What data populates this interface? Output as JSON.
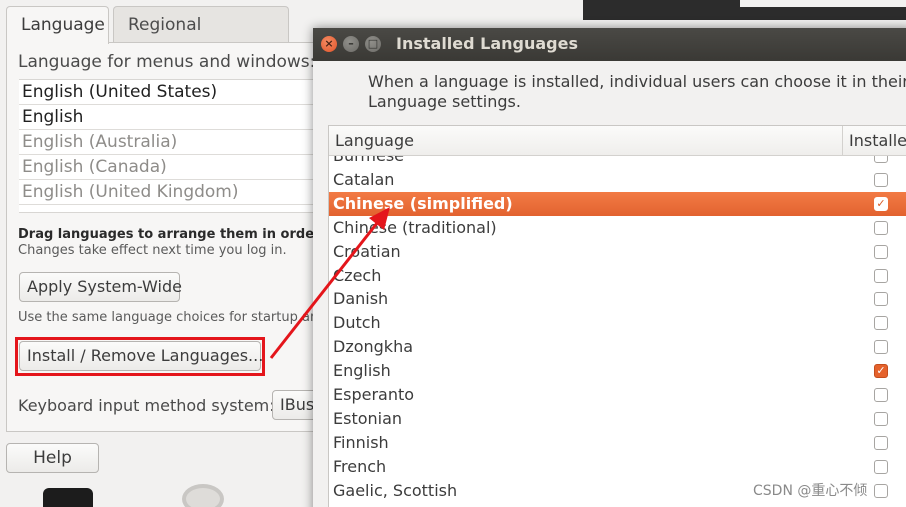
{
  "background_window": {
    "tabs": [
      "Language",
      "Regional Formats"
    ],
    "section_label": "Language for menus and windows:",
    "languages": [
      {
        "label": "English (United States)",
        "style": "strong"
      },
      {
        "label": "English",
        "style": "strong"
      },
      {
        "label": "English (Australia)",
        "style": "dim"
      },
      {
        "label": "English (Canada)",
        "style": "dim"
      },
      {
        "label": "English (United Kingdom)",
        "style": "dim"
      }
    ],
    "drag_hint_bold": "Drag languages to arrange them in order of pr",
    "drag_hint": "Changes take effect next time you log in.",
    "apply_button": "Apply System-Wide",
    "use_same_text": "Use the same language choices for startup and",
    "install_button": "Install / Remove Languages...",
    "keyboard_label": "Keyboard input method system:",
    "keyboard_value": "IBus",
    "help_button": "Help"
  },
  "dialog": {
    "title": "Installed Languages",
    "description_line1": "When a language is installed, individual users can choose it in their",
    "description_line2": "Language settings.",
    "column_language": "Language",
    "column_installed": "Installed",
    "rows": [
      {
        "name": "Burmese",
        "installed": false,
        "selected": false
      },
      {
        "name": "Catalan",
        "installed": false,
        "selected": false
      },
      {
        "name": "Chinese (simplified)",
        "installed": true,
        "selected": true
      },
      {
        "name": "Chinese (traditional)",
        "installed": false,
        "selected": false
      },
      {
        "name": "Croatian",
        "installed": false,
        "selected": false
      },
      {
        "name": "Czech",
        "installed": false,
        "selected": false
      },
      {
        "name": "Danish",
        "installed": false,
        "selected": false
      },
      {
        "name": "Dutch",
        "installed": false,
        "selected": false
      },
      {
        "name": "Dzongkha",
        "installed": false,
        "selected": false
      },
      {
        "name": "English",
        "installed": true,
        "selected": false
      },
      {
        "name": "Esperanto",
        "installed": false,
        "selected": false
      },
      {
        "name": "Estonian",
        "installed": false,
        "selected": false
      },
      {
        "name": "Finnish",
        "installed": false,
        "selected": false
      },
      {
        "name": "French",
        "installed": false,
        "selected": false
      },
      {
        "name": "Gaelic, Scottish",
        "installed": false,
        "selected": false
      }
    ]
  },
  "watermark": "CSDN @重心不倾",
  "colors": {
    "selection": "#e2622f",
    "annotation": "#e4151b",
    "titlebar": "#3a3935"
  }
}
